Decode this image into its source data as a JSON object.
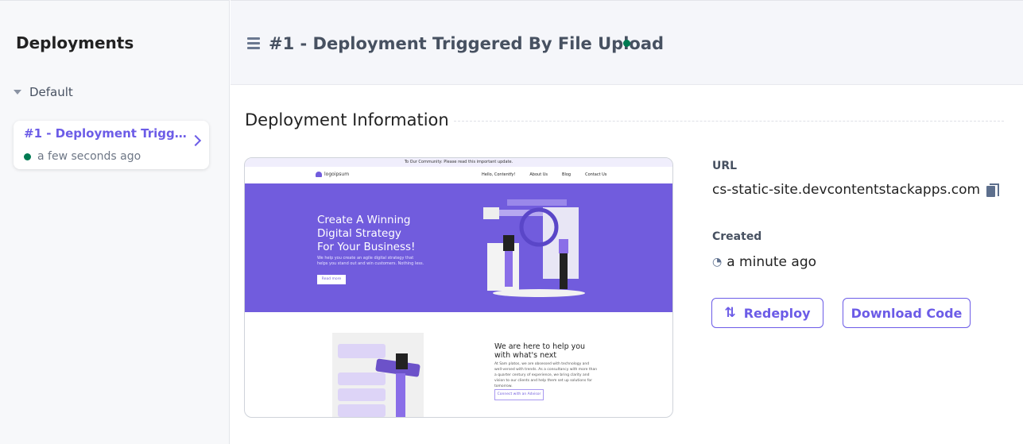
{
  "sidebar": {
    "title": "Deployments",
    "group": "Default",
    "deployment": {
      "title": "#1 - Deployment Triggered By File Upload",
      "time": "a few seconds ago",
      "status_color": "#007a52"
    }
  },
  "header": {
    "title": "#1 - Deployment Triggered By File Upload"
  },
  "section": {
    "title": "Deployment Information"
  },
  "preview": {
    "banner": "To Our Community: Please read this important update.",
    "logo": "logoipsum",
    "nav": [
      "Hello, Contentfy!",
      "About Us",
      "Blog",
      "Contact Us"
    ],
    "hero_title": "Create A Winning Digital Strategy For Your Business!",
    "hero_text": "We help you create an agile digital strategy that helps you stand out and win customers. Nothing less.",
    "hero_button": "Read more",
    "section_title": "We are here to help you with what's next",
    "section_text": "At Sam platos, we are obsessed with technology and well-versed with trends. As a consultancy with more than a quarter century of experience, we bring clarity and vision to our clients and help them set up solutions for tomorrow.",
    "section_button": "Connect with an Advisor"
  },
  "info": {
    "url_label": "URL",
    "url": "cs-static-site.devcontentstackapps.com",
    "created_label": "Created",
    "created": "a minute ago"
  },
  "actions": {
    "redeploy": "Redeploy",
    "download": "Download Code"
  }
}
